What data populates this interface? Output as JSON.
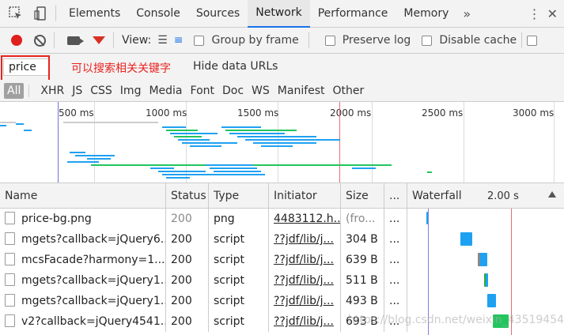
{
  "tabs": [
    "Elements",
    "Console",
    "Sources",
    "Network",
    "Performance",
    "Memory"
  ],
  "active_tab": "Network",
  "toolbar": {
    "view_label": "View:",
    "group_by_frame": "Group by frame",
    "preserve_log": "Preserve log",
    "disable_cache": "Disable cache"
  },
  "filter": {
    "search_value": "price",
    "annotation": "可以搜索相关关键字",
    "hide_data_urls": "Hide data URLs"
  },
  "types": [
    "All",
    "XHR",
    "JS",
    "CSS",
    "Img",
    "Media",
    "Font",
    "Doc",
    "WS",
    "Manifest",
    "Other"
  ],
  "overview": {
    "ticks": [
      "500 ms",
      "1000 ms",
      "1500 ms",
      "2000 ms",
      "2500 ms",
      "3000 ms"
    ]
  },
  "table": {
    "headers": {
      "name": "Name",
      "status": "Status",
      "type": "Type",
      "initiator": "Initiator",
      "size": "Size",
      "time": "...",
      "waterfall": "Waterfall",
      "waterfall_time": "2.00 s"
    },
    "rows": [
      {
        "name": "price-bg.png",
        "status": "200",
        "type": "png",
        "initiator": "4483112.h...",
        "size": "(fro...",
        "time": "..."
      },
      {
        "name": "mgets?callback=jQuery6...",
        "status": "200",
        "type": "script",
        "initiator": "??jdf/lib/j...",
        "size": "304 B",
        "time": "..."
      },
      {
        "name": "mcsFacade?harmony=1...",
        "status": "200",
        "type": "script",
        "initiator": "??jdf/lib/j...",
        "size": "639 B",
        "time": "..."
      },
      {
        "name": "mgets?callback=jQuery1...",
        "status": "200",
        "type": "script",
        "initiator": "??jdf/lib/j...",
        "size": "511 B",
        "time": "..."
      },
      {
        "name": "mgets?callback=jQuery1...",
        "status": "200",
        "type": "script",
        "initiator": "??jdf/lib/j...",
        "size": "493 B",
        "time": "..."
      },
      {
        "name": "v2?callback=jQuery4541...",
        "status": "200",
        "type": "script",
        "initiator": "??jdf/lib/j...",
        "size": "693 B",
        "time": "..."
      }
    ]
  },
  "watermark": "https://blog.csdn.net/weixin_43519454",
  "colors": {
    "accent": "#1a73e8",
    "record": "#e0201c",
    "annotation": "#e8231f",
    "bar": "#1fa1f2"
  }
}
